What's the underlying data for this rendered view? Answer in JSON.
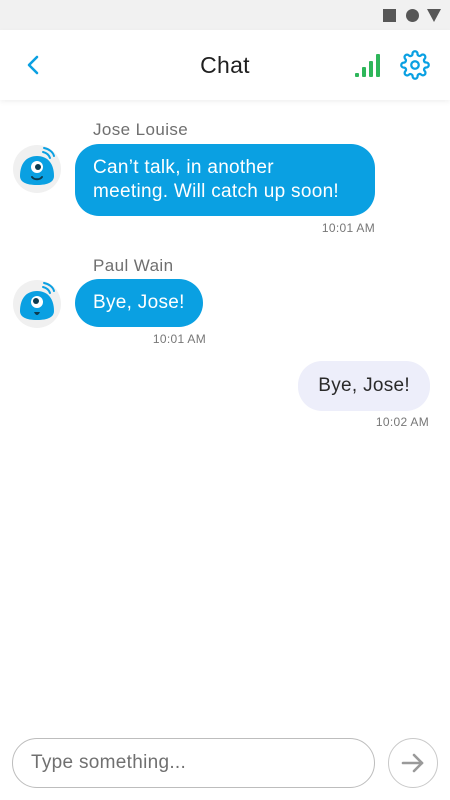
{
  "status_bar": {
    "icons": [
      "square-icon",
      "circle-icon",
      "triangle-icon"
    ],
    "icon_color": "#575757"
  },
  "header": {
    "title": "Chat",
    "back_icon": "chevron-left-icon",
    "signal_icon": "signal-bars-icon",
    "settings_icon": "gear-icon",
    "accent_color": "#0aa0e2",
    "signal_color": "#2eb65a"
  },
  "messages": [
    {
      "sender": "Jose Louise",
      "lines": [
        "Can’t talk, in another",
        "meeting. Will catch up soon!"
      ],
      "time": "10:01 AM",
      "direction": "incoming"
    },
    {
      "sender": "Paul Wain",
      "lines": [
        "Bye, Jose!"
      ],
      "time": "10:01 AM",
      "direction": "incoming"
    },
    {
      "sender": "",
      "lines": [
        "Bye, Jose!"
      ],
      "time": "10:02 AM",
      "direction": "outgoing"
    }
  ],
  "composer": {
    "placeholder": "Type something...",
    "send_icon": "arrow-right-icon"
  },
  "colors": {
    "incoming_bubble": "#0aa0e2",
    "outgoing_bubble": "#edeefa"
  }
}
